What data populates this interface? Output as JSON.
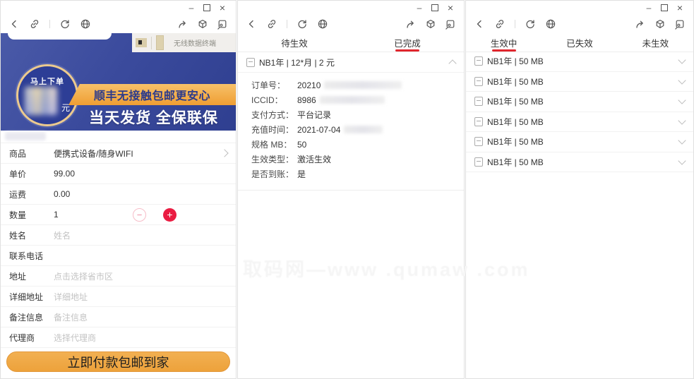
{
  "window_controls": {
    "minimize": "–",
    "close": "×"
  },
  "toolbar_icons": [
    "back-icon",
    "copy-link-icon",
    "refresh-icon",
    "globe-icon",
    "share-icon",
    "miniprogram-cube-icon",
    "pip-window-icon"
  ],
  "colors": {
    "banner_blue": "#3b4b9d",
    "strip_orange": "#f2a844",
    "pay_orange": "#efa440",
    "accent_red": "#e0262d",
    "plus_red": "#ea1c42"
  },
  "watermark": {
    "text": "取码网—www .qumaw .com"
  },
  "left": {
    "product_teaser": {
      "text": "无线数据终端"
    },
    "banner": {
      "badge_text": "马上下单",
      "badge_unit": "元",
      "strip": "顺丰无接触包邮更安心",
      "headline": "当天发货 全保联保"
    },
    "rows": [
      {
        "label": "商品",
        "value": "便携式设备/随身WIFI",
        "link": true
      },
      {
        "label": "单价",
        "value": "99.00"
      },
      {
        "label": "运费",
        "value": "0.00"
      },
      {
        "label": "数量",
        "value": "1",
        "stepper": true,
        "minus": "−",
        "plus": "+"
      },
      {
        "label": "姓名",
        "placeholder": "姓名"
      },
      {
        "label": "联系电话"
      },
      {
        "label": "地址",
        "placeholder": "点击选择省市区"
      },
      {
        "label": "详细地址",
        "placeholder": "详细地址"
      },
      {
        "label": "备注信息",
        "placeholder": "备注信息"
      },
      {
        "label": "代理商",
        "placeholder": "选择代理商"
      }
    ],
    "pay_button": "立即付款包邮到家"
  },
  "middle": {
    "tabs": [
      {
        "label": "待生效"
      },
      {
        "label": "已完成",
        "active": true
      }
    ],
    "order_header": "NB1年 | 12*月 | 2 元",
    "details": [
      {
        "label": "订单号：",
        "value": "20210",
        "redacted": true,
        "blur_w": 110
      },
      {
        "label": "ICCID：",
        "value": "8986",
        "redacted": true,
        "blur_w": 92
      },
      {
        "label": "支付方式：",
        "value": "平台记录"
      },
      {
        "label": "充值时间：",
        "value": "2021-07-04",
        "redacted": true,
        "blur_w": 55
      },
      {
        "label": "规格 MB：",
        "value": "50"
      },
      {
        "label": "生效类型：",
        "value": "激活生效"
      },
      {
        "label": "是否到账：",
        "value": "是"
      }
    ]
  },
  "right": {
    "tabs": [
      {
        "label": "生效中",
        "active": true
      },
      {
        "label": "已失效"
      },
      {
        "label": "未生效"
      }
    ],
    "items": [
      {
        "label": "NB1年 | 50 MB"
      },
      {
        "label": "NB1年 | 50 MB"
      },
      {
        "label": "NB1年 | 50 MB"
      },
      {
        "label": "NB1年 | 50 MB"
      },
      {
        "label": "NB1年 | 50 MB"
      },
      {
        "label": "NB1年 | 50 MB"
      }
    ]
  }
}
